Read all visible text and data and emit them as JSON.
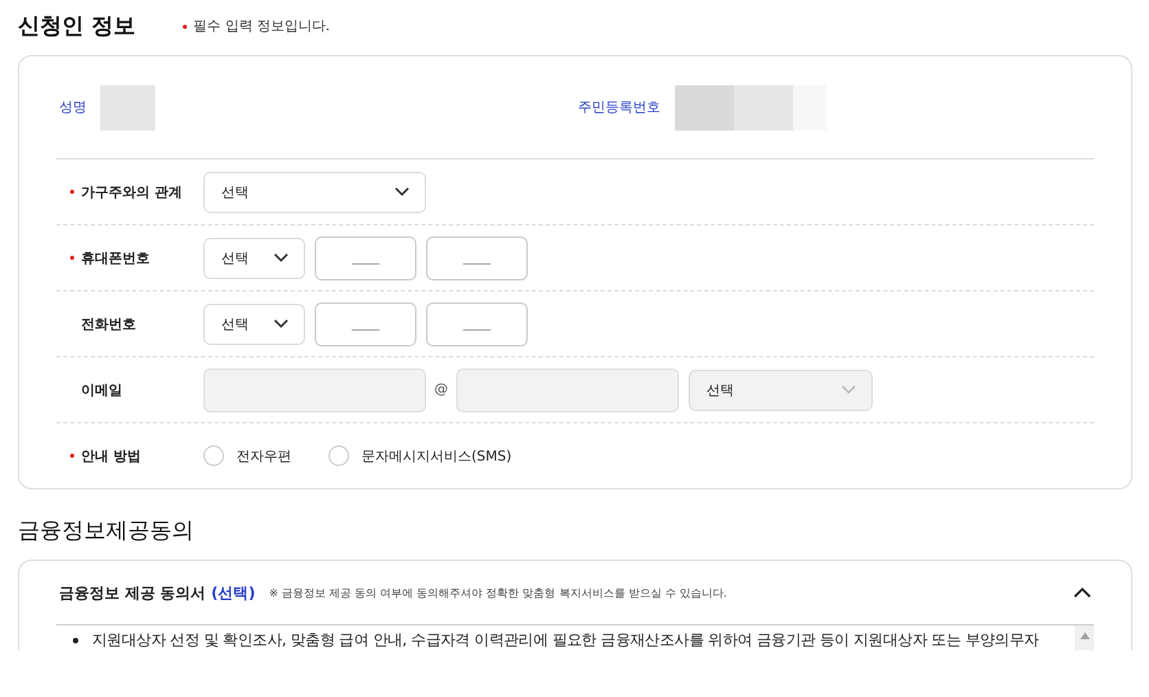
{
  "applicant": {
    "title": "신청인 정보",
    "required_note": "필수 입력 정보입니다.",
    "name_label": "성명",
    "rrn_label": "주민등록번호",
    "fields": [
      {
        "kind": "select",
        "label": "가구주와의 관계",
        "required": true,
        "select": {
          "value": "선택",
          "disabled": false
        }
      },
      {
        "kind": "phone",
        "label": "휴대폰번호",
        "required": true,
        "select": {
          "value": "선택",
          "disabled": false
        },
        "inputs": [
          {
            "placeholder": "____",
            "disabled": false
          },
          {
            "placeholder": "____",
            "disabled": false
          }
        ]
      },
      {
        "kind": "phone",
        "label": "전화번호",
        "required": false,
        "select": {
          "value": "선택",
          "disabled": false
        },
        "inputs": [
          {
            "placeholder": "____",
            "disabled": false
          },
          {
            "placeholder": "____",
            "disabled": false
          }
        ]
      },
      {
        "kind": "email",
        "label": "이메일",
        "required": false,
        "at": "@",
        "inputs": [
          {
            "disabled": true
          },
          {
            "disabled": true
          }
        ],
        "select": {
          "value": "선택",
          "disabled": true
        }
      },
      {
        "kind": "radio",
        "label": "안내 방법",
        "required": true,
        "options": [
          {
            "label": "전자우편",
            "checked": false
          },
          {
            "label": "문자메시지서비스(SMS)",
            "checked": false
          }
        ]
      }
    ]
  },
  "consent": {
    "title": "금융정보제공동의",
    "items": [
      {
        "title": "금융정보 제공 동의서",
        "tag": "(선택)",
        "note": "※ 금융정보 제공 동의 여부에 동의해주셔야 정확한 맞춤형 복지서비스를 받으실 수 있습니다.",
        "expanded": true,
        "body": [
          "지원대상자 선정 및 확인조사, 맞춤형 급여 안내, 수급자격 이력관리에 필요한 금융재산조사를 위하여 금융기관 등이 지원대상자 또는 부양의무자"
        ]
      }
    ]
  }
}
